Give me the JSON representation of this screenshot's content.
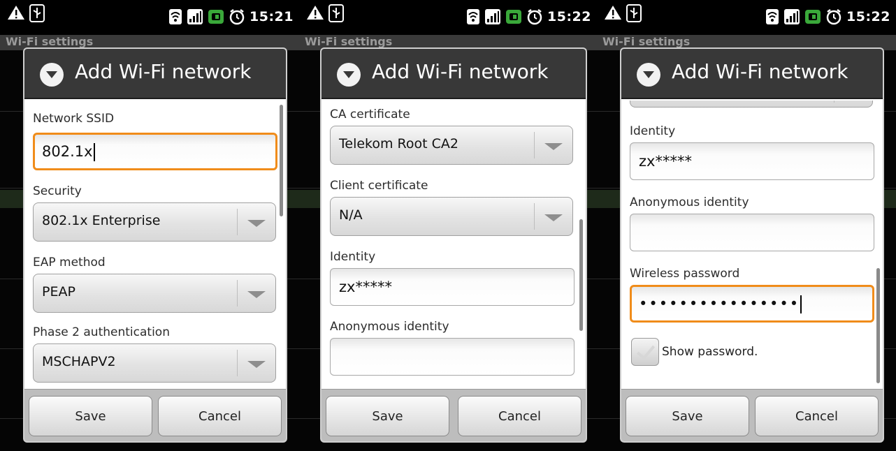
{
  "status_bar": {
    "s1_time": "15:21",
    "s2_time": "15:22",
    "s3_time": "15:22",
    "icons": [
      "warning-icon",
      "usb-icon",
      "wifi-icon",
      "signal-icon",
      "battery-icon",
      "alarm-icon"
    ]
  },
  "background": {
    "title": "Wi-Fi settings"
  },
  "dialog": {
    "title": "Add Wi-Fi network",
    "save_label": "Save",
    "cancel_label": "Cancel"
  },
  "screen1": {
    "ssid_label": "Network SSID",
    "ssid_value": "802.1x",
    "security_label": "Security",
    "security_value": "802.1x Enterprise",
    "eap_label": "EAP method",
    "eap_value": "PEAP",
    "phase2_label": "Phase 2 authentication",
    "phase2_value": "MSCHAPV2"
  },
  "screen2": {
    "ca_label": "CA certificate",
    "ca_value": "Telekom Root CA2",
    "client_label": "Client certificate",
    "client_value": "N/A",
    "identity_label": "Identity",
    "identity_value": "zx*****",
    "anon_label": "Anonymous identity",
    "anon_value": ""
  },
  "screen3": {
    "identity_label": "Identity",
    "identity_value": "zx*****",
    "anon_label": "Anonymous identity",
    "anon_value": "",
    "password_label": "Wireless password",
    "password_value": "••••••••••••••••",
    "show_password_label": "Show password."
  },
  "colors": {
    "focus_orange": "#f08c1a",
    "header_dark": "#383838",
    "footer_gray": "#bdbdbd"
  }
}
